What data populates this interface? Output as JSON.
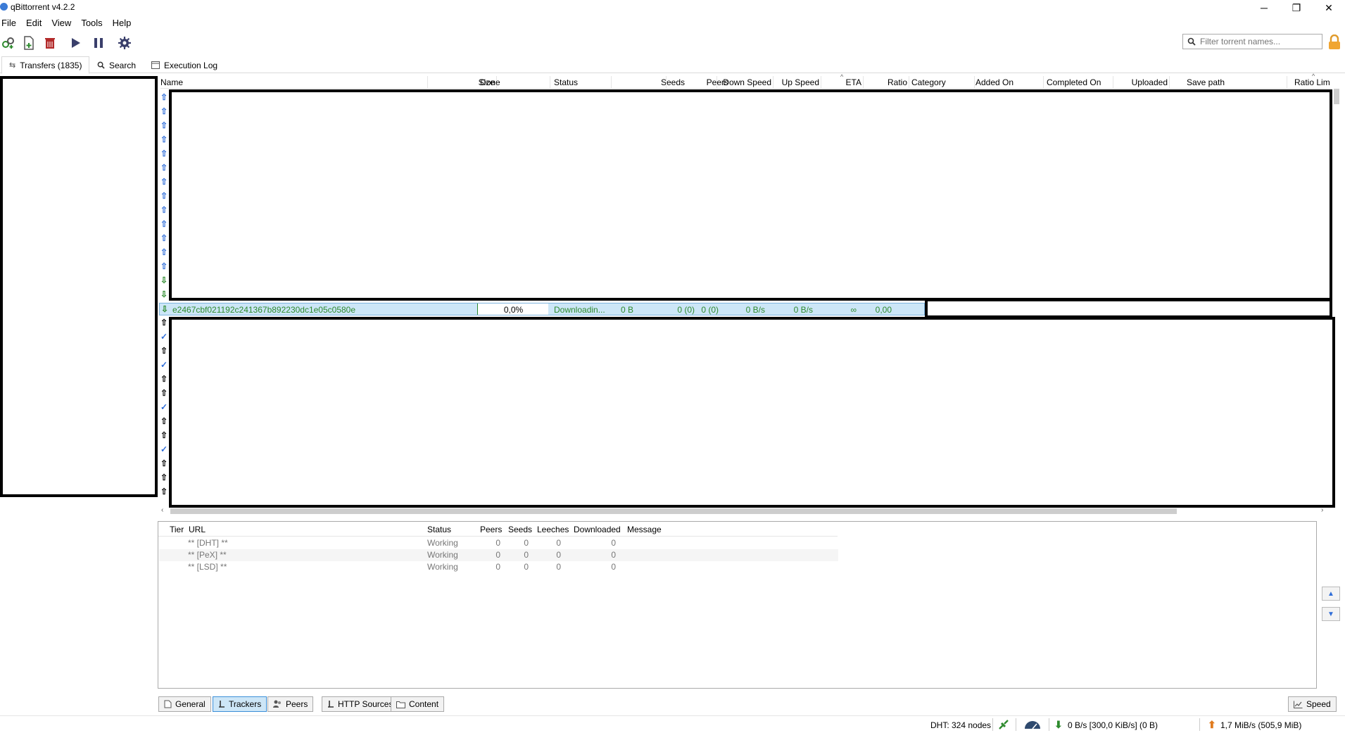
{
  "window": {
    "title": "qBittorrent v4.2.2",
    "minimize": "─",
    "restore": "❐",
    "close": "✕"
  },
  "menu": [
    "File",
    "Edit",
    "View",
    "Tools",
    "Help"
  ],
  "toolbar": {
    "filter_placeholder": "Filter torrent names..."
  },
  "tabs": {
    "transfers": "Transfers (1835)",
    "search": "Search",
    "log": "Execution Log"
  },
  "columns": {
    "name": "Name",
    "size": "Size",
    "done": "Done",
    "status": "Status",
    "seeds": "Seeds",
    "peers": "Peers",
    "down_speed": "Down Speed",
    "up_speed": "Up Speed",
    "eta": "ETA",
    "ratio": "Ratio",
    "category": "Category",
    "added_on": "Added On",
    "completed_on": "Completed On",
    "uploaded": "Uploaded",
    "save_path": "Save path",
    "ratio_limit": "Ratio Lim"
  },
  "selected_torrent": {
    "name": "e2467cbf021192c241367b892230dc1e05c0580e",
    "size": "0 B",
    "done": "0,0%",
    "progress": 0.0,
    "status": "Downloadin...",
    "seeds": "0 (0)",
    "peers": "0 (0)",
    "down_speed": "0 B/s",
    "up_speed": "0 B/s",
    "eta": "∞",
    "ratio": "0,00"
  },
  "trackers": {
    "headers": {
      "tier": "Tier",
      "url": "URL",
      "status": "Status",
      "peers": "Peers",
      "seeds": "Seeds",
      "leeches": "Leeches",
      "downloaded": "Downloaded",
      "message": "Message"
    },
    "rows": [
      {
        "url": "** [DHT] **",
        "status": "Working",
        "peers": "0",
        "seeds": "0",
        "leeches": "0",
        "downloaded": "0"
      },
      {
        "url": "** [PeX] **",
        "status": "Working",
        "peers": "0",
        "seeds": "0",
        "leeches": "0",
        "downloaded": "0"
      },
      {
        "url": "** [LSD] **",
        "status": "Working",
        "peers": "0",
        "seeds": "0",
        "leeches": "0",
        "downloaded": "0"
      }
    ]
  },
  "bottom_tabs": {
    "general": "General",
    "trackers": "Trackers",
    "peers": "Peers",
    "http_sources": "HTTP Sources",
    "content": "Content",
    "speed": "Speed"
  },
  "status": {
    "dht": "DHT: 324 nodes",
    "download": "0 B/s [300,0 KiB/s] (0 B)",
    "upload": "1,7 MiB/s (505,9 MiB)"
  },
  "colors": {
    "downloading": "#2e8b2e",
    "selection": "#cce6f7",
    "accent": "#2f6dd8"
  }
}
